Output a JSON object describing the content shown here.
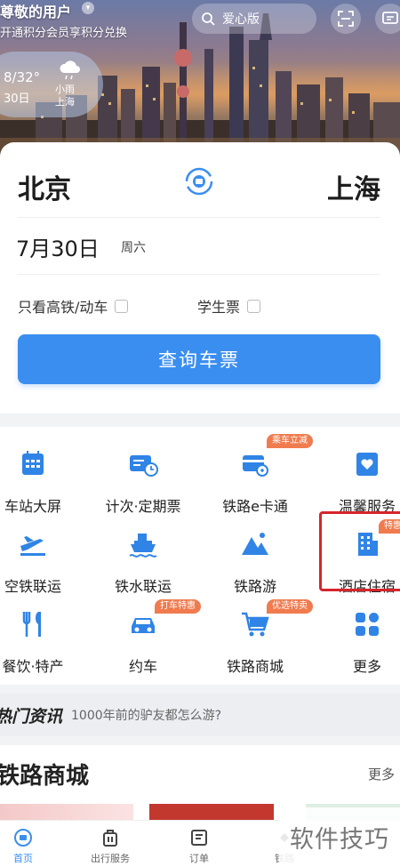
{
  "header": {
    "greeting": "尊敬的用户",
    "sub_greeting": "开通积分会员享积分兑换",
    "search_placeholder": "爱心版",
    "weather": {
      "temp": "8/32°",
      "date": "30日",
      "condition": "小雨",
      "city": "上海"
    }
  },
  "ticket": {
    "from": "北京",
    "to": "上海",
    "date": "7月30日",
    "weekday": "周六",
    "opt_high_speed": "只看高铁/动车",
    "opt_student": "学生票",
    "query_button": "查询车票"
  },
  "services": [
    {
      "label": "车站大屏",
      "icon": "station-screen-icon",
      "tag": ""
    },
    {
      "label": "计次·定期票",
      "icon": "ticket-clock-icon",
      "tag": ""
    },
    {
      "label": "铁路e卡通",
      "icon": "ecard-icon",
      "tag": "乘车立减"
    },
    {
      "label": "温馨服务",
      "icon": "heart-service-icon",
      "tag": ""
    },
    {
      "label": "空铁联运",
      "icon": "plane-train-icon",
      "tag": ""
    },
    {
      "label": "铁水联运",
      "icon": "ship-icon",
      "tag": ""
    },
    {
      "label": "铁路游",
      "icon": "mountain-icon",
      "tag": ""
    },
    {
      "label": "酒店住宿",
      "icon": "hotel-icon",
      "tag": "特惠"
    },
    {
      "label": "餐饮·特产",
      "icon": "food-icon",
      "tag": ""
    },
    {
      "label": "约车",
      "icon": "car-icon",
      "tag": "打车特惠"
    },
    {
      "label": "铁路商城",
      "icon": "cart-icon",
      "tag": "优选特卖"
    },
    {
      "label": "更多",
      "icon": "more-grid-icon",
      "tag": ""
    }
  ],
  "news": {
    "title": "热门资讯",
    "headline": "1000年前的驴友都怎么游?"
  },
  "mall": {
    "title": "铁路商城",
    "more": "更多"
  },
  "tabs": [
    {
      "label": "首页"
    },
    {
      "label": "出行服务"
    },
    {
      "label": "订单"
    },
    {
      "label": "铁路"
    }
  ],
  "watermark": "软件技巧",
  "colors": {
    "primary": "#3a8ef0",
    "tag": "#f07b4e",
    "highlight": "#d6262b"
  }
}
